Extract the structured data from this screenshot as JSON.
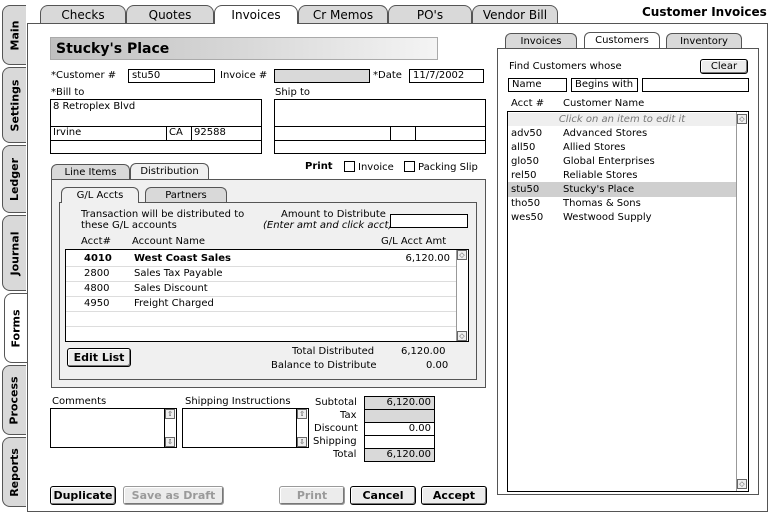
{
  "window_title": "Customer Invoices",
  "side_tabs": [
    "Main",
    "Settings",
    "Ledger",
    "Journal",
    "Forms",
    "Process",
    "Reports"
  ],
  "top_tabs": [
    "Checks",
    "Quotes",
    "Invoices",
    "Cr Memos",
    "PO's",
    "Vendor Bill"
  ],
  "header": {
    "customer_name": "Stucky's Place"
  },
  "form": {
    "customer_label": "*Customer #",
    "customer_value": "stu50",
    "invoice_label": "Invoice #",
    "invoice_value": "",
    "date_label": "*Date",
    "date_value": "11/7/2002",
    "bill_to_label": "*Bill to",
    "ship_to_label": "Ship to",
    "bill_address": "8 Retroplex Blvd",
    "bill_city": "Irvine",
    "bill_state": "CA",
    "bill_zip": "92588"
  },
  "form_tabs": [
    "Line Items",
    "Distribution"
  ],
  "print": {
    "label": "Print",
    "invoice": "Invoice",
    "packing_slip": "Packing Slip"
  },
  "dist_tabs": [
    "G/L Accts",
    "Partners"
  ],
  "distribution": {
    "note": "Transaction will be distributed to\nthese G/L accounts",
    "amount_label": "Amount to Distribute",
    "amount_hint": "(Enter amt and click acct)",
    "amount_value": "",
    "col_acct": "Acct#",
    "col_name": "Account Name",
    "col_amt": "G/L Acct Amt",
    "rows": [
      {
        "acct": "4010",
        "name": "West Coast Sales",
        "amt": "6,120.00"
      },
      {
        "acct": "2800",
        "name": "Sales Tax Payable",
        "amt": ""
      },
      {
        "acct": "4800",
        "name": "Sales Discount",
        "amt": ""
      },
      {
        "acct": "4950",
        "name": "Freight Charged",
        "amt": ""
      }
    ],
    "edit_list": "Edit List",
    "total_distributed_label": "Total Distributed",
    "total_distributed": "6,120.00",
    "balance_label": "Balance to Distribute",
    "balance": "0.00"
  },
  "comments_label": "Comments",
  "shipping_instructions_label": "Shipping Instructions",
  "totals": {
    "subtotal_label": "Subtotal",
    "subtotal": "6,120.00",
    "tax_label": "Tax",
    "tax": "",
    "discount_label": "Discount",
    "discount": "0.00",
    "shipping_label": "Shipping",
    "shipping": "",
    "total_label": "Total",
    "total": "6,120.00"
  },
  "buttons": {
    "duplicate": "Duplicate",
    "save_draft": "Save as Draft",
    "print": "Print",
    "cancel": "Cancel",
    "accept": "Accept"
  },
  "right_tabs": [
    "Invoices",
    "Customers",
    "Inventory"
  ],
  "finder": {
    "label": "Find Customers whose",
    "clear": "Clear",
    "field": "Name",
    "op": "Begins with",
    "value": "",
    "col_acct": "Acct #",
    "col_name": "Customer Name",
    "hint": "Click on an item to edit it",
    "rows": [
      {
        "acct": "adv50",
        "name": "Advanced Stores"
      },
      {
        "acct": "all50",
        "name": "Allied Stores"
      },
      {
        "acct": "glo50",
        "name": "Global Enterprises"
      },
      {
        "acct": "rel50",
        "name": "Reliable Stores"
      },
      {
        "acct": "stu50",
        "name": "Stucky's Place",
        "selected": true
      },
      {
        "acct": "tho50",
        "name": "Thomas & Sons"
      },
      {
        "acct": "wes50",
        "name": "Westwood Supply"
      }
    ]
  }
}
